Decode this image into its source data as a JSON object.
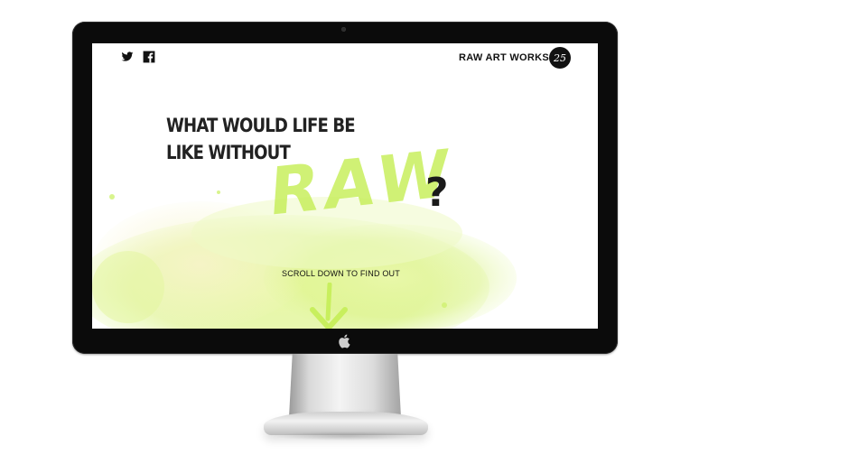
{
  "social": {
    "twitter_icon": "twitter-icon",
    "facebook_icon": "facebook-icon"
  },
  "brand": {
    "name": "RAW ART WORKS",
    "badge": "25"
  },
  "hero": {
    "line1": "WHAT WOULD LIFE BE",
    "line2": "LIKE WITHOUT",
    "raw_word": "RAW",
    "question_mark": "?",
    "scroll_text": "SCROLL DOWN TO FIND OUT"
  },
  "colors": {
    "accent": "#c8ef5d",
    "text": "#222222",
    "bezel": "#0b0b0b"
  }
}
